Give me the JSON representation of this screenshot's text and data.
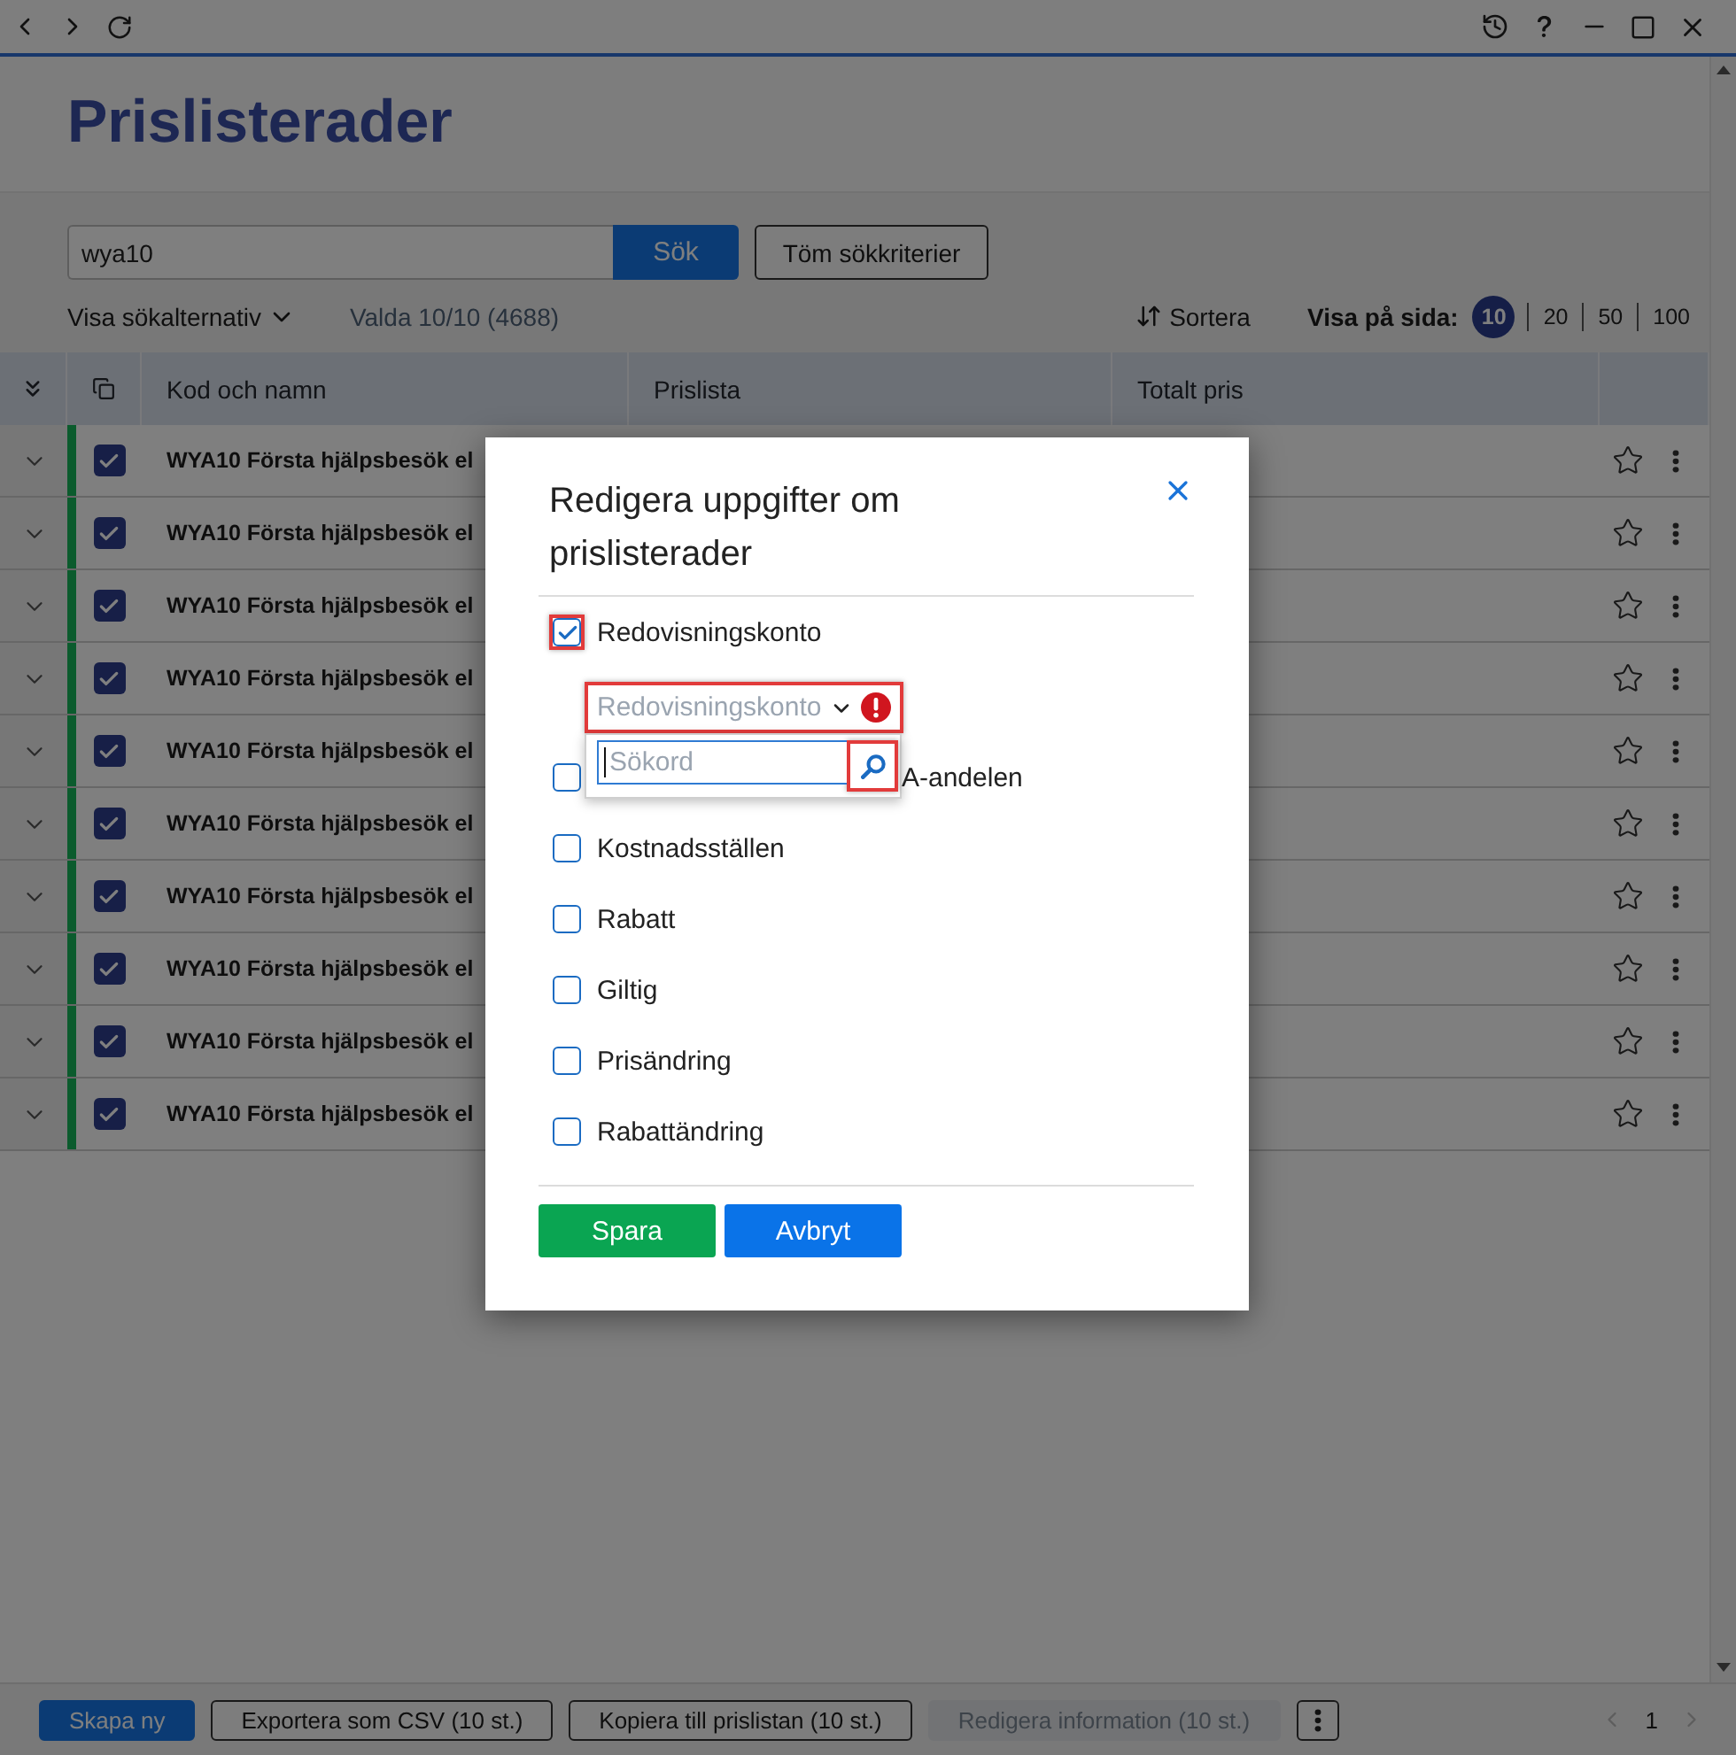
{
  "header": {
    "title": "Prislisterader"
  },
  "search": {
    "value": "wya10",
    "submit": "Sök",
    "clear": "Töm sökkriterier",
    "options_toggle": "Visa sökalternativ",
    "selection_summary": "Valda 10/10 (4688)",
    "sort": "Sortera",
    "page_size_label": "Visa på sida:",
    "page_sizes": [
      {
        "label": "10",
        "selected": true
      },
      {
        "label": "20",
        "selected": false
      },
      {
        "label": "50",
        "selected": false
      },
      {
        "label": "100",
        "selected": false
      }
    ]
  },
  "table": {
    "columns": [
      "Kod och namn",
      "Prislista",
      "Totalt pris"
    ],
    "rows": [
      {
        "name": "WYA10 Första hjälpsbesök el",
        "checked": true,
        "expanded": false,
        "favorite": false
      },
      {
        "name": "WYA10 Första hjälpsbesök el",
        "checked": true,
        "expanded": false,
        "favorite": false
      },
      {
        "name": "WYA10 Första hjälpsbesök el",
        "checked": true,
        "expanded": false,
        "favorite": false
      },
      {
        "name": "WYA10 Första hjälpsbesök el",
        "checked": true,
        "expanded": false,
        "favorite": false
      },
      {
        "name": "WYA10 Första hjälpsbesök el",
        "checked": true,
        "expanded": false,
        "favorite": false
      },
      {
        "name": "WYA10 Första hjälpsbesök el",
        "checked": true,
        "expanded": false,
        "favorite": false
      },
      {
        "name": "WYA10 Första hjälpsbesök el",
        "checked": true,
        "expanded": false,
        "favorite": false
      },
      {
        "name": "WYA10 Första hjälpsbesök el",
        "checked": true,
        "expanded": false,
        "favorite": false
      },
      {
        "name": "WYA10 Första hjälpsbesök el",
        "checked": true,
        "expanded": false,
        "favorite": false
      },
      {
        "name": "WYA10 Första hjälpsbesök el",
        "checked": true,
        "expanded": false,
        "favorite": false
      }
    ]
  },
  "dialog": {
    "title": "Redigera uppgifter om prislisterader",
    "options": [
      {
        "label": "Redovisningskonto",
        "checked": true,
        "highlighted": true,
        "dropdown": {
          "placeholder": "Redovisningskonto",
          "error": true,
          "highlighted": true,
          "open": true,
          "search": {
            "placeholder": "Sökord",
            "focused": true,
            "button_highlighted": true
          }
        }
      },
      {
        "label": "A-andelen",
        "checked": false,
        "highlighted": false
      },
      {
        "label": "Kostnadsställen",
        "checked": false,
        "highlighted": false
      },
      {
        "label": "Rabatt",
        "checked": false,
        "highlighted": false
      },
      {
        "label": "Giltig",
        "checked": false,
        "highlighted": false
      },
      {
        "label": "Prisändring",
        "checked": false,
        "highlighted": false
      },
      {
        "label": "Rabattändring",
        "checked": false,
        "highlighted": false
      }
    ],
    "buttons": [
      {
        "label": "Spara",
        "kind": "save"
      },
      {
        "label": "Avbryt",
        "kind": "cancel"
      }
    ]
  },
  "footer": {
    "buttons": [
      {
        "label": "Skapa ny",
        "kind": "primary",
        "disabled": false
      },
      {
        "label": "Exportera som CSV (10 st.)",
        "kind": "outline",
        "disabled": false
      },
      {
        "label": "Kopiera till prislistan (10 st.)",
        "kind": "outline",
        "disabled": false
      },
      {
        "label": "Redigera information (10 st.)",
        "kind": "outline",
        "disabled": true
      }
    ],
    "pagination": {
      "current": "1",
      "previous_disabled": true,
      "next_disabled": true
    }
  }
}
